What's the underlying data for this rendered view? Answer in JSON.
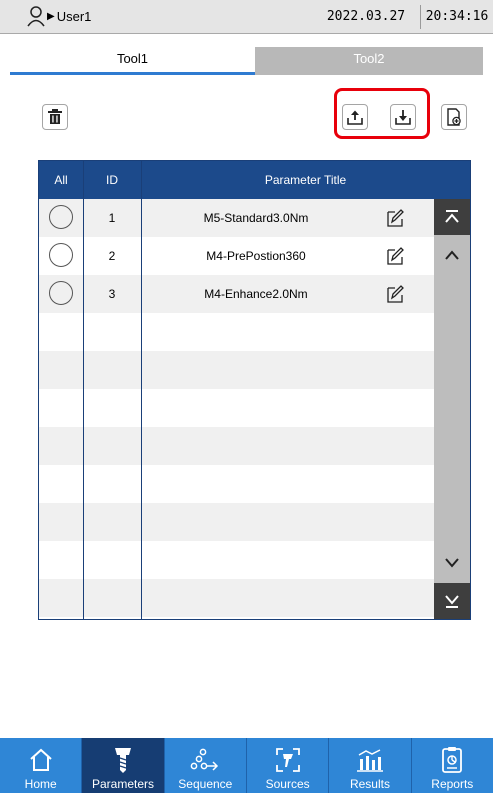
{
  "status_bar": {
    "user": "User1",
    "date": "2022.03.27",
    "time": "20:34:16"
  },
  "tabs": [
    {
      "label": "Tool1",
      "active": true
    },
    {
      "label": "Tool2",
      "active": false
    }
  ],
  "table": {
    "headers": {
      "all": "All",
      "id": "ID",
      "title": "Parameter Title"
    },
    "rows": [
      {
        "id": "1",
        "title": "M5-Standard3.0Nm"
      },
      {
        "id": "2",
        "title": "M4-PrePostion360"
      },
      {
        "id": "3",
        "title": "M4-Enhance2.0Nm"
      }
    ]
  },
  "nav": [
    {
      "label": "Home",
      "icon": "home-icon"
    },
    {
      "label": "Parameters",
      "icon": "screw-icon",
      "active": true
    },
    {
      "label": "Sequence",
      "icon": "sequence-icon"
    },
    {
      "label": "Sources",
      "icon": "sources-icon"
    },
    {
      "label": "Results",
      "icon": "results-icon"
    },
    {
      "label": "Reports",
      "icon": "reports-icon"
    }
  ],
  "colors": {
    "header": "#1c4a8b",
    "nav": "#2f86d6",
    "nav_active": "#163d73",
    "highlight": "#e8000b",
    "tab_underline": "#2f7bd1"
  }
}
